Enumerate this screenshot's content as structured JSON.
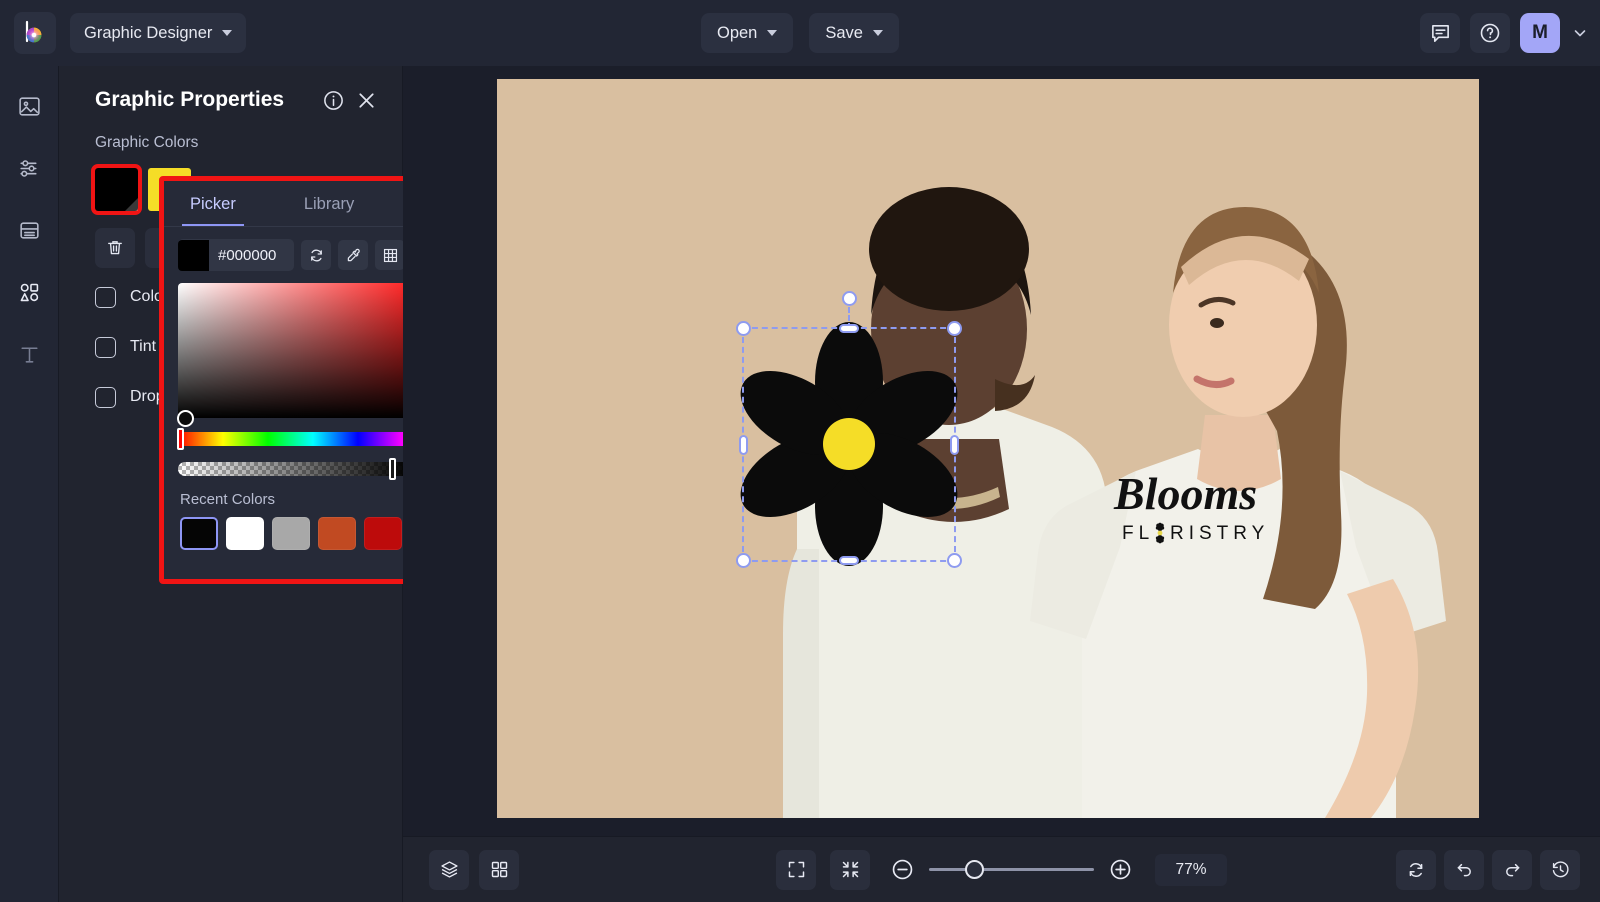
{
  "topbar": {
    "logo_name": "brand-logo",
    "workspace": "Graphic Designer",
    "open_label": "Open",
    "save_label": "Save",
    "feedback_icon": "comment-icon",
    "help_icon": "help-circle-icon",
    "avatar_initial": "M"
  },
  "rail": {
    "items": [
      {
        "icon": "image-icon",
        "name": "image-tool"
      },
      {
        "icon": "adjustments-icon",
        "name": "adjustments-tool"
      },
      {
        "icon": "layers-panel-icon",
        "name": "layout-tool"
      },
      {
        "icon": "shapes-icon",
        "name": "graphics-tool"
      },
      {
        "icon": "text-icon",
        "name": "text-tool"
      }
    ]
  },
  "panel": {
    "title": "Graphic Properties",
    "info_icon": "info-icon",
    "close_icon": "close-icon",
    "section_label": "Graphic Colors",
    "swatches": [
      {
        "name": "color-swatch-black",
        "color": "#000000",
        "selected": true
      },
      {
        "name": "color-swatch-yellow",
        "color": "#f5dd27",
        "selected": false
      }
    ],
    "tools": [
      {
        "name": "delete-button",
        "icon": "trash-icon"
      },
      {
        "name": "duplicate-button",
        "icon": "copy-icon"
      }
    ],
    "options": [
      {
        "label": "Color Overlay",
        "checked": false
      },
      {
        "label": "Tint",
        "checked": false
      },
      {
        "label": "Drop Shadow",
        "checked": false
      }
    ]
  },
  "picker": {
    "tabs": [
      {
        "label": "Picker",
        "active": true
      },
      {
        "label": "Library",
        "active": false
      }
    ],
    "hex_value": "#000000",
    "swatch_color": "#000000",
    "actions": [
      {
        "name": "convert-color-button",
        "icon": "refresh-icon"
      },
      {
        "name": "eyedropper-button",
        "icon": "eyedropper-icon"
      },
      {
        "name": "palette-grid-button",
        "icon": "grid-icon"
      },
      {
        "name": "add-color-button",
        "icon": "plus-icon"
      }
    ],
    "hue": 0,
    "alpha_value": "100",
    "recent_label": "Recent Colors",
    "recent_colors": [
      {
        "color": "#050505",
        "selected": true
      },
      {
        "color": "#ffffff",
        "selected": false
      },
      {
        "color": "#a8a8a8",
        "selected": false
      },
      {
        "color": "#c14a22",
        "selected": false
      },
      {
        "color": "#bd0b0b",
        "selected": false
      },
      {
        "color": "#fa0f0f",
        "selected": false
      }
    ]
  },
  "canvas": {
    "artwork_name": "flower-graphic",
    "petal_color": "#0b0b0b",
    "center_color": "#f5dd27",
    "shirt_logo_title": "Blooms",
    "shirt_logo_subtitle": "FL   RISTRY",
    "background_color": "#d9bfa0",
    "selection": {
      "handles": 8,
      "rotation_handle": true
    }
  },
  "bottombar": {
    "left_buttons": [
      {
        "name": "layers-button",
        "icon": "layers-icon"
      },
      {
        "name": "thumbnails-button",
        "icon": "grid-squares-icon"
      }
    ],
    "center_buttons": [
      {
        "name": "fit-screen-button",
        "icon": "expand-icon"
      },
      {
        "name": "fit-content-button",
        "icon": "collapse-icon"
      },
      {
        "name": "zoom-out-button",
        "icon": "minus-circle-icon"
      },
      {
        "name": "zoom-in-button",
        "icon": "plus-circle-icon"
      }
    ],
    "zoom_level": "77%",
    "right_buttons": [
      {
        "name": "reset-button",
        "icon": "refresh-icon"
      },
      {
        "name": "undo-button",
        "icon": "undo-icon"
      },
      {
        "name": "redo-button",
        "icon": "redo-icon"
      },
      {
        "name": "history-button",
        "icon": "history-icon"
      }
    ]
  }
}
